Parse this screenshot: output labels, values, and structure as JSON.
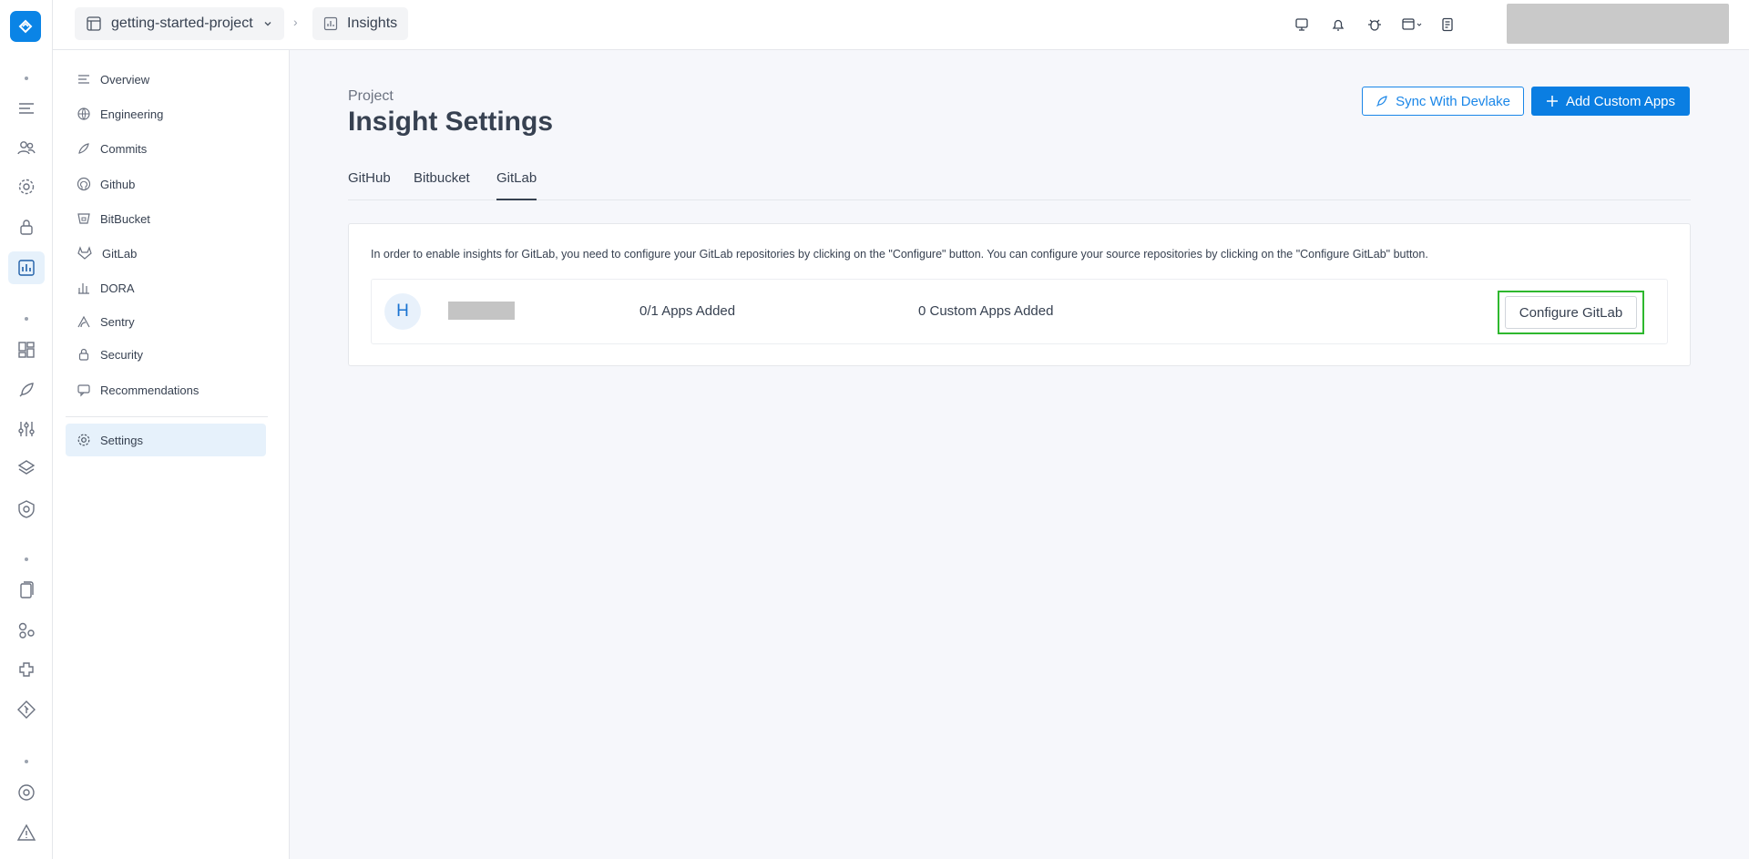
{
  "breadcrumb": {
    "project": "getting-started-project",
    "page": "Insights"
  },
  "sidebar": {
    "items": [
      {
        "label": "Overview",
        "icon": "lines-icon"
      },
      {
        "label": "Engineering",
        "icon": "globe-icon"
      },
      {
        "label": "Commits",
        "icon": "commit-icon"
      },
      {
        "label": "Github",
        "icon": "github-icon"
      },
      {
        "label": "BitBucket",
        "icon": "bitbucket-icon"
      },
      {
        "label": "GitLab",
        "icon": "gitlab-icon"
      },
      {
        "label": "DORA",
        "icon": "bar-chart-icon"
      },
      {
        "label": "Sentry",
        "icon": "sentry-icon"
      },
      {
        "label": "Security",
        "icon": "lock-icon"
      },
      {
        "label": "Recommendations",
        "icon": "message-icon"
      },
      {
        "label": "Settings",
        "icon": "gear-icon"
      }
    ],
    "active": "Settings"
  },
  "header": {
    "eyebrow": "Project",
    "title": "Insight Settings",
    "sync_label": "Sync With Devlake",
    "add_label": "Add Custom Apps"
  },
  "tabs": [
    {
      "label": "GitHub"
    },
    {
      "label": "Bitbucket"
    },
    {
      "label": "GitLab"
    }
  ],
  "active_tab": "GitLab",
  "card": {
    "info": "In order to enable insights for GitLab, you need to configure your GitLab repositories by clicking on the \"Configure\" button. You can configure your source repositories by clicking on the \"Configure GitLab\" button.",
    "repo": {
      "avatar_letter": "H",
      "apps_added": "0/1 Apps Added",
      "custom_apps_added": "0 Custom Apps Added",
      "configure_label": "Configure GitLab"
    }
  },
  "colors": {
    "accent": "#0a7ee2",
    "highlight": "#2eb82e",
    "active_bg": "#e6f1fb"
  }
}
